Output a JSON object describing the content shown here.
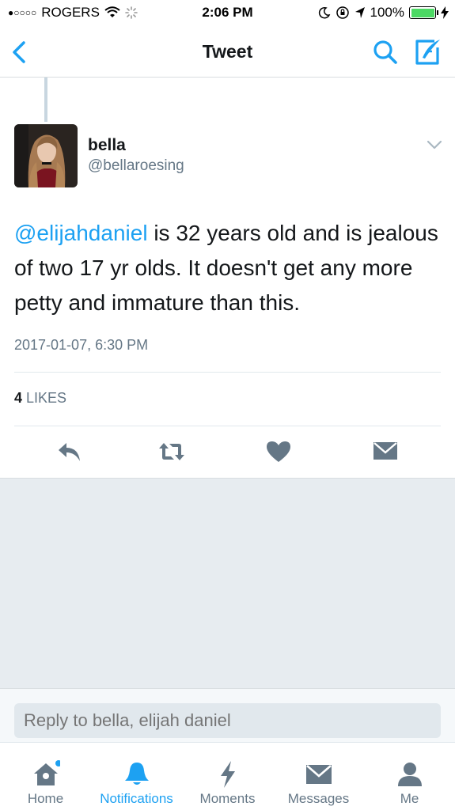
{
  "status_bar": {
    "carrier": "ROGERS",
    "time": "2:06 PM",
    "battery": "100%",
    "signal_dots": "●○○○○"
  },
  "nav": {
    "title": "Tweet"
  },
  "tweet": {
    "author_name": "bella",
    "author_handle": "@bellaroesing",
    "mention": "@elijahdaniel",
    "text": " is 32 years old and is jealous of two 17 yr olds. It doesn't get any more petty and immature than this.",
    "timestamp": "2017-01-07, 6:30 PM",
    "likes_count": "4",
    "likes_label": "LIKES"
  },
  "reply": {
    "placeholder": "Reply to bella, elijah daniel"
  },
  "tabs": [
    {
      "label": "Home",
      "icon": "home-icon",
      "active": false
    },
    {
      "label": "Notifications",
      "icon": "bell-icon",
      "active": true
    },
    {
      "label": "Moments",
      "icon": "lightning-icon",
      "active": false
    },
    {
      "label": "Messages",
      "icon": "envelope-icon",
      "active": false
    },
    {
      "label": "Me",
      "icon": "person-icon",
      "active": false
    }
  ],
  "colors": {
    "accent": "#1da1f2",
    "icon_gray": "#657786",
    "background_gray": "#e7ecf0",
    "battery_green": "#4cd964"
  }
}
